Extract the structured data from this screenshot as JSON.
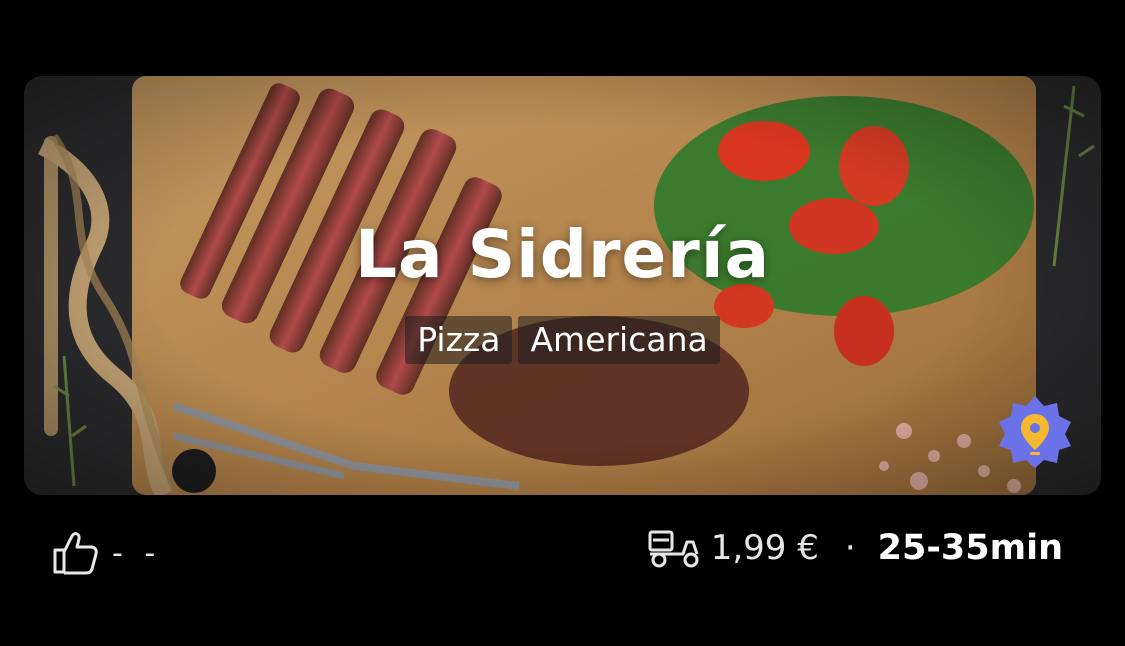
{
  "restaurant": {
    "name": "La Sidrería",
    "tags": [
      "Pizza",
      "Americana"
    ]
  },
  "rating": {
    "icon": "thumbs-up-icon",
    "value": "- -"
  },
  "delivery": {
    "icon": "delivery-scooter-icon",
    "fee": "1,99 €",
    "separator": "·",
    "time": "25-35min"
  },
  "badge": {
    "icon": "location-pin-badge-icon",
    "color": "#6b72e8",
    "pin_color": "#f5b82e"
  },
  "hero": {
    "description_icon": "steak-board-image"
  }
}
